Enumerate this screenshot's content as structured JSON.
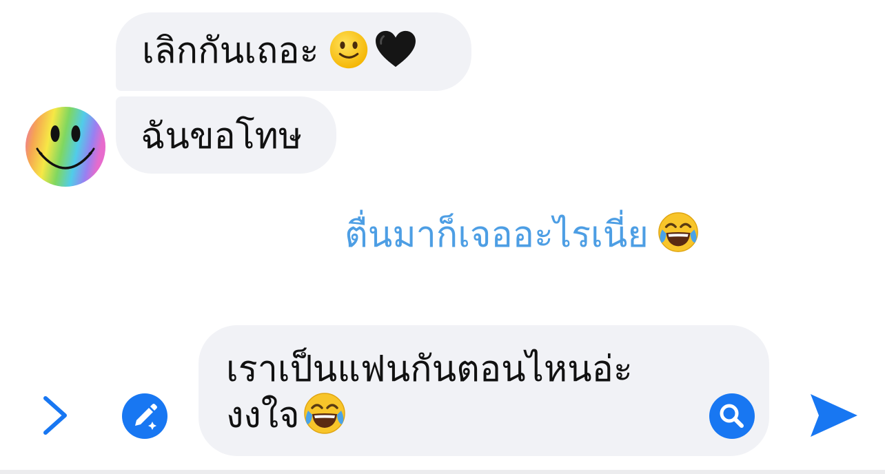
{
  "conversation": {
    "incoming": [
      {
        "text": "เลิกกันเถอะ",
        "emojis": [
          "slightly-smiling-face",
          "black-heart"
        ]
      },
      {
        "text": "ฉันขอโทษ",
        "emojis": []
      }
    ],
    "outgoing": [
      {
        "text": "ตื่นมาก็เจออะไรเนี่ย",
        "emojis": [
          "face-with-tears-of-joy"
        ]
      }
    ],
    "contact_avatar": "rainbow-smiley-face"
  },
  "composer": {
    "draft_line1": "เราเป็นแฟนกันตอนไหนอ่ะ",
    "draft_line2": "งงใจ",
    "draft_emoji": "face-with-tears-of-joy"
  },
  "colors": {
    "accent": "#1877f2",
    "outgoing_text": "#4d9ee4",
    "bubble_background": "#f1f2f6",
    "text": "#111111"
  },
  "icons": {
    "expand": "chevron-right-icon",
    "compose": "pencil-sparkle-icon",
    "search": "search-icon",
    "send": "send-icon"
  }
}
